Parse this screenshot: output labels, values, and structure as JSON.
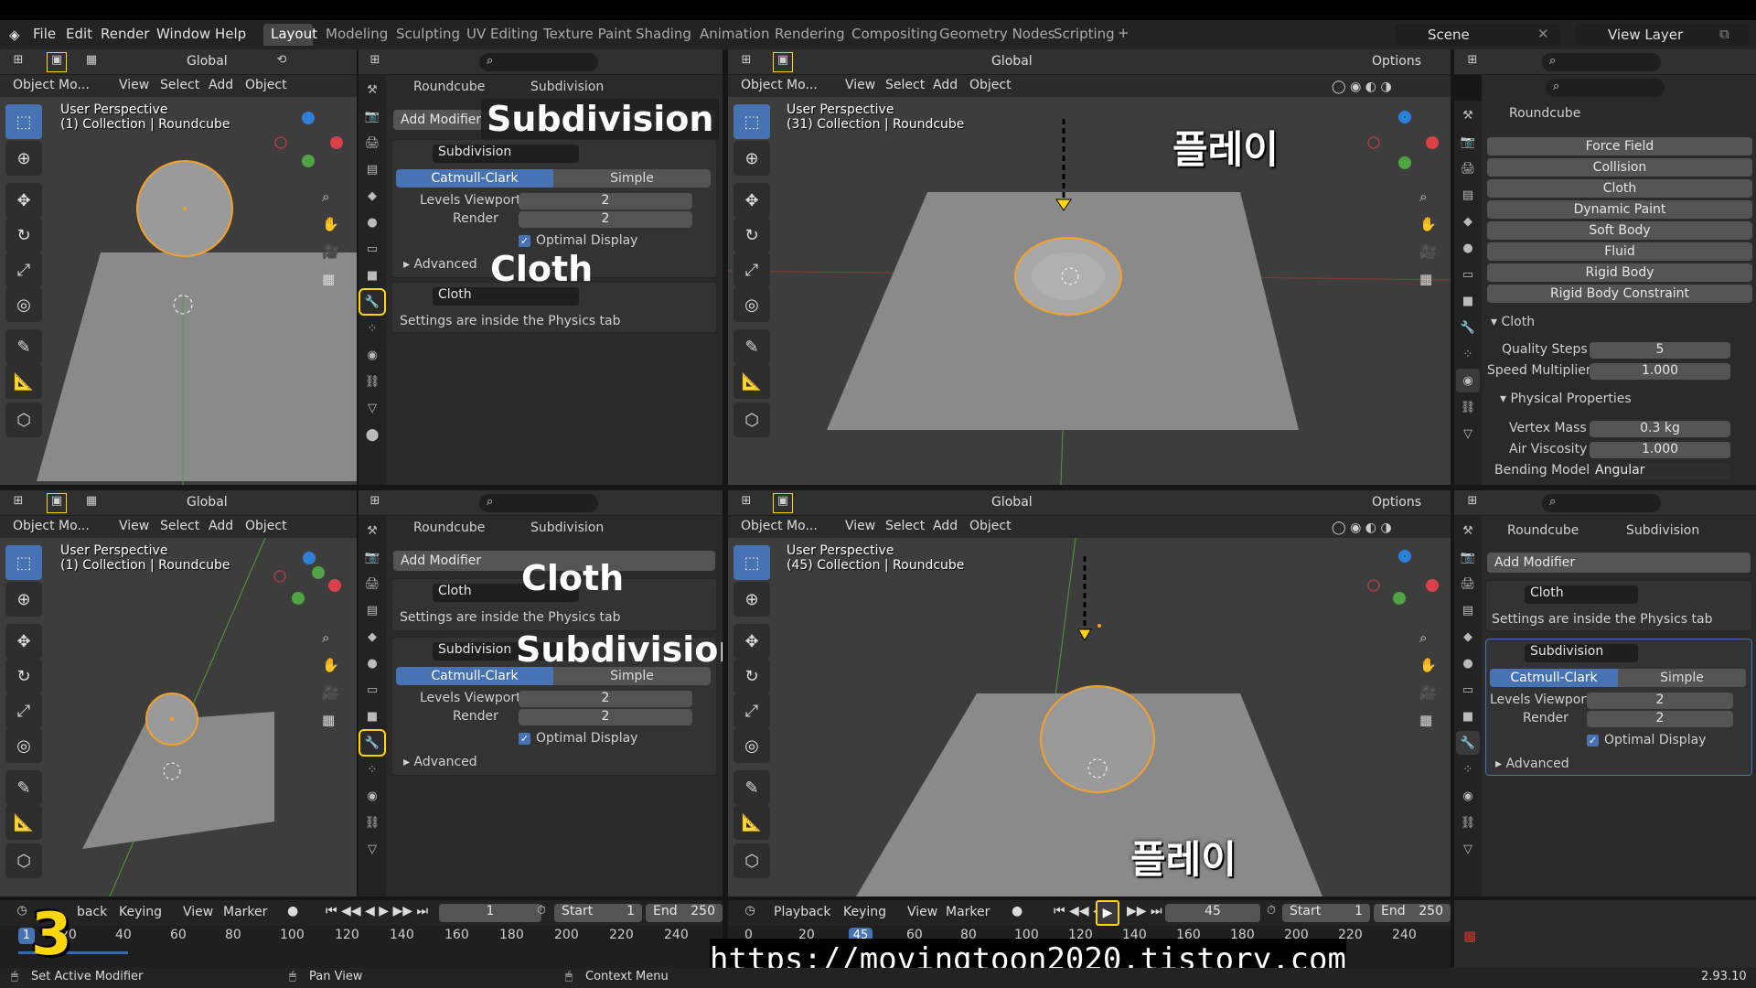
{
  "menu": {
    "items": [
      "File",
      "Edit",
      "Render",
      "Window",
      "Help"
    ],
    "workspaces": [
      "Layout",
      "Modeling",
      "Sculpting",
      "UV Editing",
      "Texture Paint",
      "Shading",
      "Animation",
      "Rendering",
      "Compositing",
      "Geometry Nodes",
      "Scripting"
    ],
    "active_workspace": "Layout",
    "scene": "Scene",
    "view_layer": "View Layer"
  },
  "vp_header": {
    "orientation": "Global",
    "options": "Options",
    "mode": "Object Mo...",
    "view": "View",
    "select": "Select",
    "add": "Add",
    "object": "Object"
  },
  "viewports": {
    "tl": {
      "line1": "User Perspective",
      "line2": "(1) Collection | Roundcube"
    },
    "tr": {
      "line1": "User Perspective",
      "line2": "(31) Collection | Roundcube"
    },
    "bl": {
      "line1": "User Perspective",
      "line2": "(1) Collection | Roundcube"
    },
    "br": {
      "line1": "User Perspective",
      "line2": "(45) Collection | Roundcube"
    }
  },
  "modifiers": {
    "object": "Roundcube",
    "modifier_crumb": "Subdivision",
    "add_modifier": "Add Modifier",
    "subdivision_name": "Subdivision",
    "catmull": "Catmull-Clark",
    "simple": "Simple",
    "levels_viewport_label": "Levels Viewport",
    "levels_viewport": "2",
    "render_label": "Render",
    "render": "2",
    "optimal_display": "Optimal Display",
    "advanced": "Advanced",
    "cloth_name": "Cloth",
    "cloth_note": "Settings are inside the Physics tab"
  },
  "physics": {
    "object": "Roundcube",
    "buttons": [
      "Force Field",
      "Collision",
      "Cloth",
      "Dynamic Paint",
      "Soft Body",
      "Fluid",
      "Rigid Body",
      "Rigid Body Constraint"
    ],
    "cloth_section": "Cloth",
    "quality_label": "Quality Steps",
    "quality": "5",
    "speed_label": "Speed Multiplier",
    "speed": "1.000",
    "phys_section": "Physical Properties",
    "mass_label": "Vertex Mass",
    "mass": "0.3 kg",
    "air_label": "Air Viscosity",
    "air": "1.000",
    "bending_label": "Bending Model",
    "bending": "Angular"
  },
  "overlays": {
    "subdivision": "Subdivision",
    "cloth": "Cloth",
    "play_kr": "플레이",
    "step_number": "3",
    "url": "https://movingtoon2020.tistory.com"
  },
  "timeline": {
    "playback": "Playback",
    "playback_clipped": "back",
    "keying": "Keying",
    "view": "View",
    "marker": "Marker",
    "frame_left": "1",
    "frame_right": "45",
    "start_label": "Start",
    "start": "1",
    "end_label": "End",
    "end": "250",
    "ticks_left": [
      "20",
      "40",
      "60",
      "80",
      "100",
      "120",
      "140",
      "160",
      "180",
      "200",
      "220",
      "240"
    ],
    "ticks_right": [
      "0",
      "20",
      "40",
      "60",
      "80",
      "100",
      "120",
      "140",
      "160",
      "180",
      "200",
      "220",
      "240"
    ],
    "current_left": "1",
    "current_right": "45"
  },
  "status": {
    "set_active": "Set Active Modifier",
    "pan": "Pan View",
    "context": "Context Menu",
    "version": "2.93.10"
  },
  "colors": {
    "accent": "#4772b3",
    "highlight": "#ffd60a",
    "selection": "#f4a22a"
  }
}
